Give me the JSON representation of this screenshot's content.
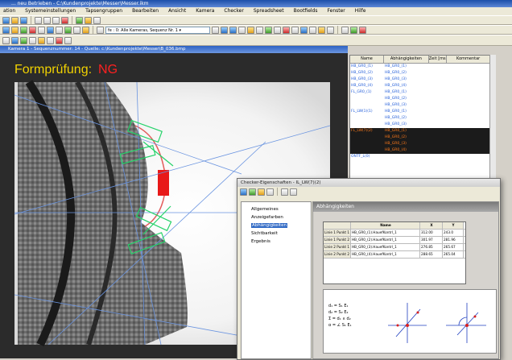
{
  "app": {
    "title": "... neu Betrieben - C:\\Kundenprojekte\\Messer\\Messer.ikm"
  },
  "menu": [
    "ation",
    "Systemeinstellungen",
    "Tapsengruppen",
    "Bearbeiten",
    "Ansicht",
    "Kamera",
    "Checker",
    "Spreadsheet",
    "Bootfields",
    "Fenster",
    "Hilfe"
  ],
  "toolbar": {
    "camera_combo": "fe : 0: Alle Kameras, Sequenz Nr. 1"
  },
  "camera_window": {
    "title": "Kamera 1 - Sequenznummer: 14 - Quelle: c:\\Kundenprojekte\\Messer\\B_036.bmp",
    "label": "Formprüfung:",
    "result": "NG"
  },
  "dep_table": {
    "columns": [
      "Name",
      "Abhängigkeiten",
      "Zeit [ms]",
      "Kommentar"
    ],
    "rows": [
      {
        "name": "HB_GR0_(1)",
        "dep": "HB_GR0_(1)",
        "time": "",
        "comment": ""
      },
      {
        "name": "HB_GR0_(2)",
        "dep": "HB_GR0_(2)",
        "time": "",
        "comment": ""
      },
      {
        "name": "HB_GR0_(3)",
        "dep": "HB_GR0_(3)",
        "time": "",
        "comment": ""
      },
      {
        "name": "HB_GR0_(4)",
        "dep": "HB_GR0_(4)",
        "time": "",
        "comment": ""
      },
      {
        "name": "FL_GR0_(1)",
        "dep": "HB_GR0_(1)",
        "time": "",
        "comment": ""
      },
      {
        "name": "",
        "dep": "HB_GR0_(2)",
        "time": "",
        "comment": ""
      },
      {
        "name": "",
        "dep": "HB_GR0_(3)",
        "time": "",
        "comment": ""
      },
      {
        "name": "FL_LW(1)(1)",
        "dep": "HB_GR0_(1)",
        "time": "",
        "comment": ""
      },
      {
        "name": "",
        "dep": "HB_GR0_(2)",
        "time": "",
        "comment": ""
      },
      {
        "name": "",
        "dep": "HB_GR0_(3)",
        "time": "",
        "comment": ""
      },
      {
        "name": "FL_LW(7)(2)",
        "dep": "HB_GR0_(1)",
        "time": "",
        "comment": ""
      },
      {
        "name": "",
        "dep": "HB_GR0_(2)",
        "time": "",
        "comment": ""
      },
      {
        "name": "",
        "dep": "HB_GR0_(3)",
        "time": "",
        "comment": ""
      },
      {
        "name": "",
        "dep": "HB_GR0_(4)",
        "time": "",
        "comment": ""
      },
      {
        "name": "ONTF_L(0)",
        "dep": "",
        "time": "",
        "comment": ""
      }
    ]
  },
  "dialog": {
    "title": "Checker-Eigenschaften - IL_LW(7)(2)",
    "tree": [
      "Allgemeines",
      "Anzeigefarben",
      "Abhängigkeiten",
      "Sichtbarkeit",
      "Ergebnis"
    ],
    "selected": "Abhängigkeiten",
    "panel_title": "Abhängigkeiten",
    "grid": {
      "columns": [
        "",
        "Name",
        "X",
        "Y"
      ],
      "rows": [
        [
          "Linie 1 Punkt 1",
          "HB_GR0_(1).HauefKontrl_1",
          "312.00",
          "243.0"
        ],
        [
          "Linie 1 Punkt 2",
          "HB_GR0_(2).HauefKontrl_1",
          "301.97",
          "281.96"
        ],
        [
          "Linie 2 Punkt 1",
          "HB_GR0_(3).HauefKontrl_1",
          "276.85",
          "265.67"
        ],
        [
          "Linie 2 Punkt 2",
          "HB_GR0_(4).HauefKontrl_1",
          "288.65",
          "265.04"
        ]
      ]
    },
    "formula": [
      "d₁ = S₁ E₁",
      "d₂ = S₂ E₂",
      "Σ = d₁ ∧ d₂",
      "α = ∠ S₁ E₁"
    ]
  },
  "colors": {
    "accent": "#f1d200",
    "ng": "#ff2020",
    "selection": "#316ac5"
  }
}
